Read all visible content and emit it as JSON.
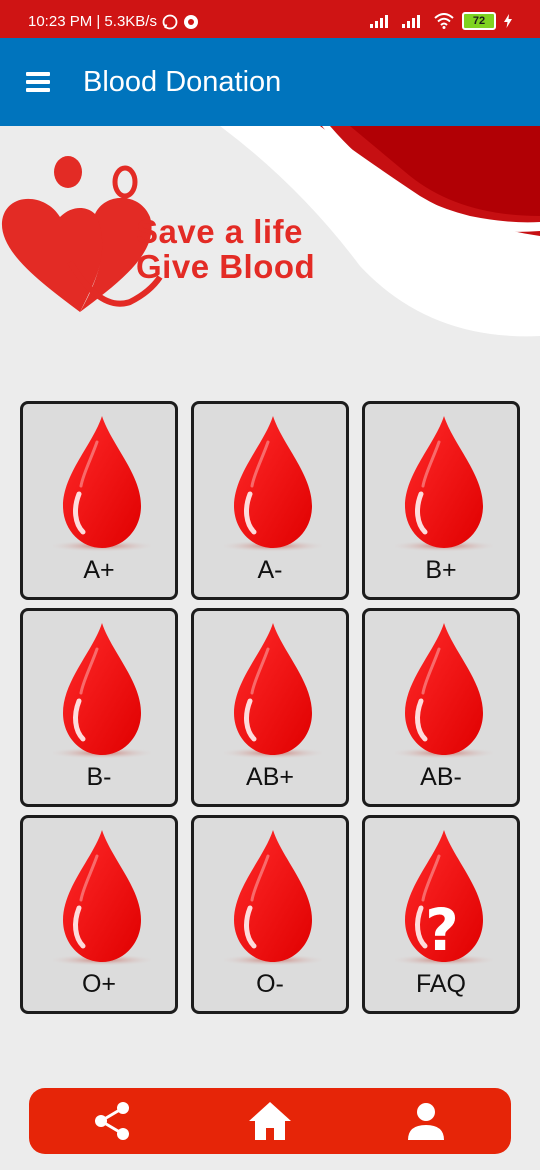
{
  "status_bar": {
    "time_speed": "10:23 PM | 5.3KB/s",
    "battery": "72"
  },
  "app_bar": {
    "title": "Blood Donation",
    "menu_icon": "hamburger-menu-icon"
  },
  "banner": {
    "line1": "Save a life",
    "line2": "Give Blood"
  },
  "blood_groups": [
    {
      "label": "A+"
    },
    {
      "label": "A-"
    },
    {
      "label": "B+"
    },
    {
      "label": "B-"
    },
    {
      "label": "AB+"
    },
    {
      "label": "AB-"
    },
    {
      "label": "O+"
    },
    {
      "label": "O-"
    },
    {
      "label": "FAQ",
      "icon": "question-mark-icon"
    }
  ],
  "bottom_nav": {
    "items": [
      "share-icon",
      "home-icon",
      "profile-icon"
    ]
  },
  "colors": {
    "status_bar": "#cf1414",
    "app_bar": "#0074bd",
    "drop_red": "#ff0000",
    "bottom_nav": "#e62508"
  }
}
